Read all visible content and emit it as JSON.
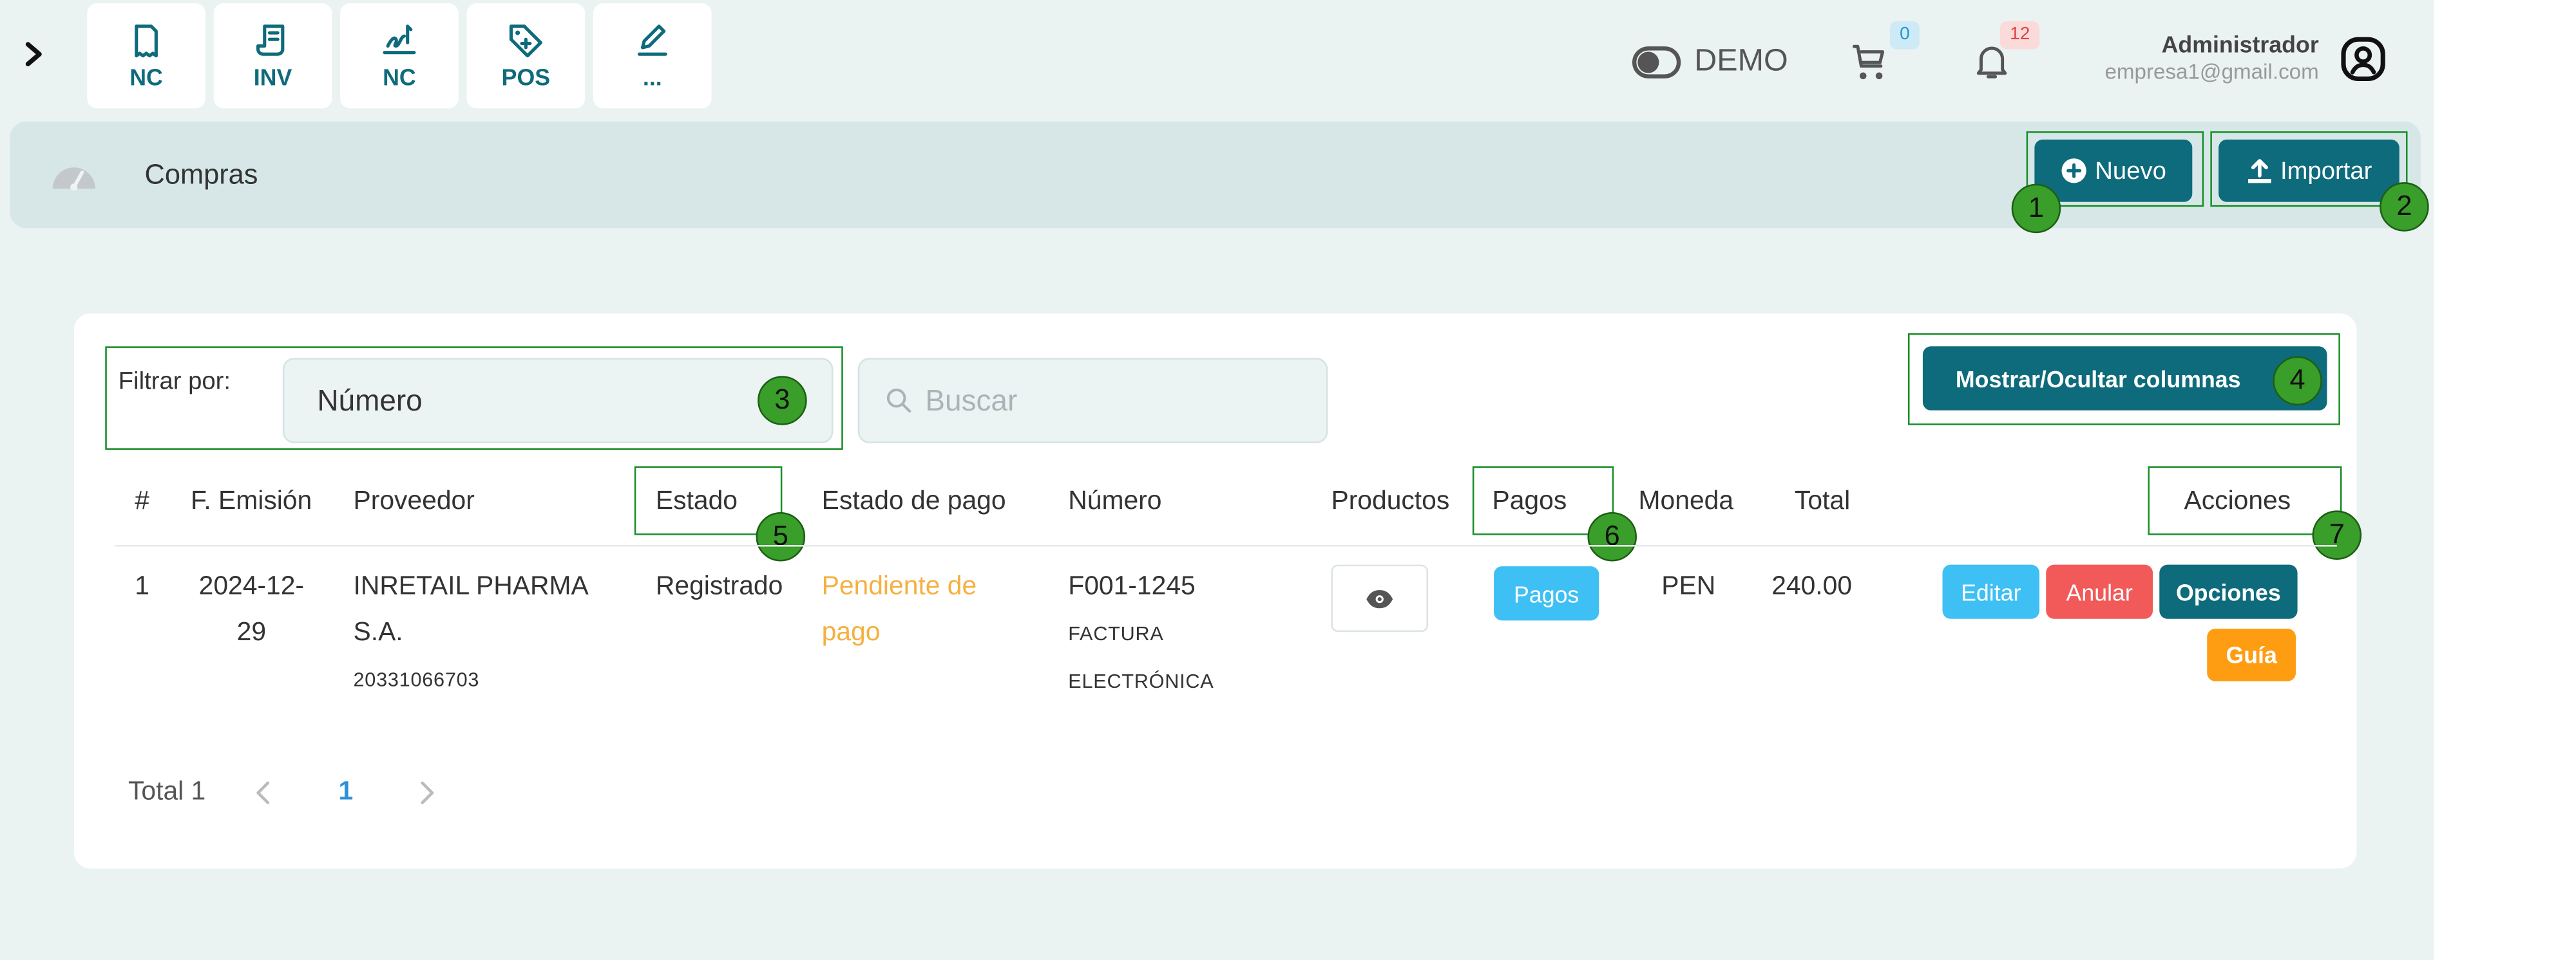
{
  "topbar": {
    "quick_buttons": [
      {
        "label": "NC",
        "icon": "receipt-icon"
      },
      {
        "label": "INV",
        "icon": "invoice-icon"
      },
      {
        "label": "NC",
        "icon": "signature-icon"
      },
      {
        "label": "POS",
        "icon": "tag-icon"
      },
      {
        "label": "...",
        "icon": "pencil-icon"
      }
    ],
    "demo_label": "DEMO",
    "cart_count": "0",
    "notifications_count": "12",
    "user_name": "Administrador",
    "user_email": "empresa1@gmail.com"
  },
  "subheader": {
    "title": "Compras",
    "new_label": "Nuevo",
    "import_label": "Importar"
  },
  "annotations": [
    "1",
    "2",
    "3",
    "4",
    "5",
    "6",
    "7"
  ],
  "filters": {
    "label": "Filtrar por:",
    "selected": "Número",
    "search_placeholder": "Buscar",
    "columns_button": "Mostrar/Ocultar columnas"
  },
  "table": {
    "headers": [
      "#",
      "F. Emisión",
      "Proveedor",
      "Estado",
      "Estado de pago",
      "Número",
      "Productos",
      "Pagos",
      "Moneda",
      "Total",
      "Acciones"
    ],
    "rows": [
      {
        "index": "1",
        "date_line1": "2024-12-",
        "date_line2": "29",
        "supplier_line1": "INRETAIL PHARMA",
        "supplier_line2": "S.A.",
        "supplier_ruc": "20331066703",
        "status": "Registrado",
        "payment_status_line1": "Pendiente de",
        "payment_status_line2": "pago",
        "number": "F001-1245",
        "doc_type_line1": "FACTURA",
        "doc_type_line2": "ELECTRÓNICA",
        "payments_label": "Pagos",
        "currency": "PEN",
        "total": "240.00",
        "actions": {
          "edit": "Editar",
          "void": "Anular",
          "options": "Opciones",
          "guide": "Guía"
        }
      }
    ]
  },
  "pagination": {
    "total_label": "Total 1",
    "current_page": "1"
  },
  "colors": {
    "primary": "#0e6b7b",
    "info": "#3ec0f5",
    "danger": "#f25a5a",
    "warning": "#ff9d12",
    "pending_text": "#f5b041",
    "annotation": "#3a9e2a"
  }
}
